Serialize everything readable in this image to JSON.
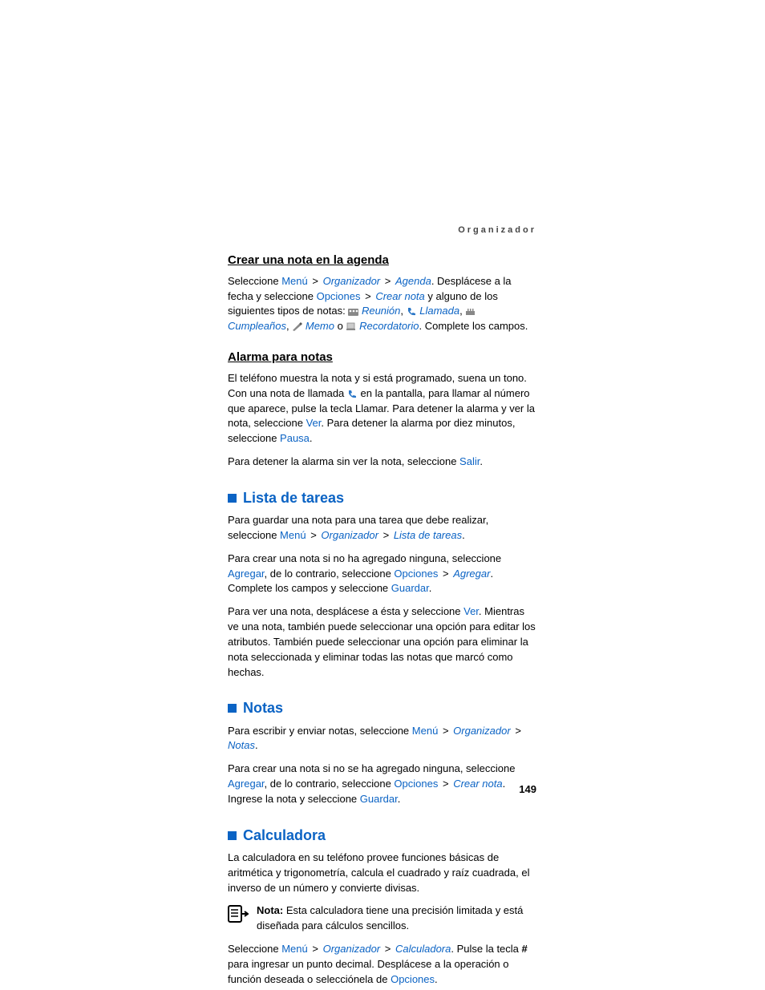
{
  "running_head": "Organizador",
  "page_number": "149",
  "crear_nota": {
    "heading": "Crear una nota en la agenda",
    "p_a": "Seleccione ",
    "menu": "Menú",
    "gt": ">",
    "org": "Organizador",
    "agenda": "Agenda",
    "p_b": ". Desplácese a la fecha y seleccione ",
    "opciones": "Opciones",
    "crear": "Crear nota",
    "p_c": " y alguno de los siguientes tipos de notas: ",
    "reunion": "Reunión",
    "llamada": "Llamada",
    "cumple": "Cumpleaños",
    "memo": "Memo",
    "o": " o ",
    "record": "Recordatorio",
    "end": ". Complete los campos.",
    "comma": ", "
  },
  "alarma": {
    "heading": "Alarma para notas",
    "p1_a": "El teléfono muestra la nota y si está programado, suena un tono. Con una nota de llamada ",
    "p1_b": " en la pantalla, para llamar al número que aparece, pulse la tecla Llamar. Para detener la alarma y ver la nota, seleccione ",
    "ver": "Ver",
    "p1_c": ". Para detener la alarma por diez minutos, seleccione ",
    "pausa": "Pausa",
    "dot": ".",
    "p2_a": "Para detener la alarma sin ver la nota, seleccione ",
    "salir": "Salir"
  },
  "lista": {
    "heading": "Lista de tareas",
    "p1_a": "Para guardar una nota para una tarea que debe realizar, seleccione ",
    "menu": "Menú",
    "gt": ">",
    "org": "Organizador",
    "ldt": "Lista de tareas",
    "dot": ".",
    "p2_a": "Para crear una nota si no ha agregado ninguna, seleccione ",
    "agregar": "Agregar",
    "p2_b": ", de lo contrario, seleccione ",
    "opciones": "Opciones",
    "agregar2": "Agregar",
    "p2_c": ". Complete los campos y seleccione ",
    "guardar": "Guardar",
    "p3_a": "Para ver una nota, desplácese a ésta y seleccione ",
    "ver": "Ver",
    "p3_b": ". Mientras ve una nota, también puede seleccionar una opción para editar los atributos. También puede seleccionar una opción para eliminar la nota seleccionada y eliminar todas las notas que marcó como hechas."
  },
  "notas": {
    "heading": "Notas",
    "p1_a": "Para escribir y enviar notas, seleccione ",
    "menu": "Menú",
    "gt": ">",
    "org": "Organizador",
    "notas": "Notas",
    "dot": ".",
    "p2_a": "Para crear una nota si no se ha agregado ninguna, seleccione ",
    "agregar": "Agregar",
    "p2_b": ", de lo contrario, seleccione ",
    "opciones": "Opciones",
    "crear": "Crear nota",
    "p2_c": ". Ingrese la nota y seleccione ",
    "guardar": "Guardar"
  },
  "calc": {
    "heading": "Calculadora",
    "p1": "La calculadora en su teléfono provee funciones básicas de aritmética y trigonometría, calcula el cuadrado y raíz cuadrada, el inverso de un número y convierte divisas.",
    "note_label": "Nota:",
    "note_text": " Esta calculadora tiene una precisión limitada y está diseñada para cálculos sencillos.",
    "p2_a": "Seleccione ",
    "menu": "Menú",
    "gt": ">",
    "org": "Organizador",
    "calc": "Calculadora",
    "p2_b": ". Pulse la tecla ",
    "hash": "#",
    "p2_c": " para ingresar un punto decimal. Desplácese a la operación o función deseada o selecciónela de ",
    "opciones": "Opciones",
    "dot": "."
  }
}
